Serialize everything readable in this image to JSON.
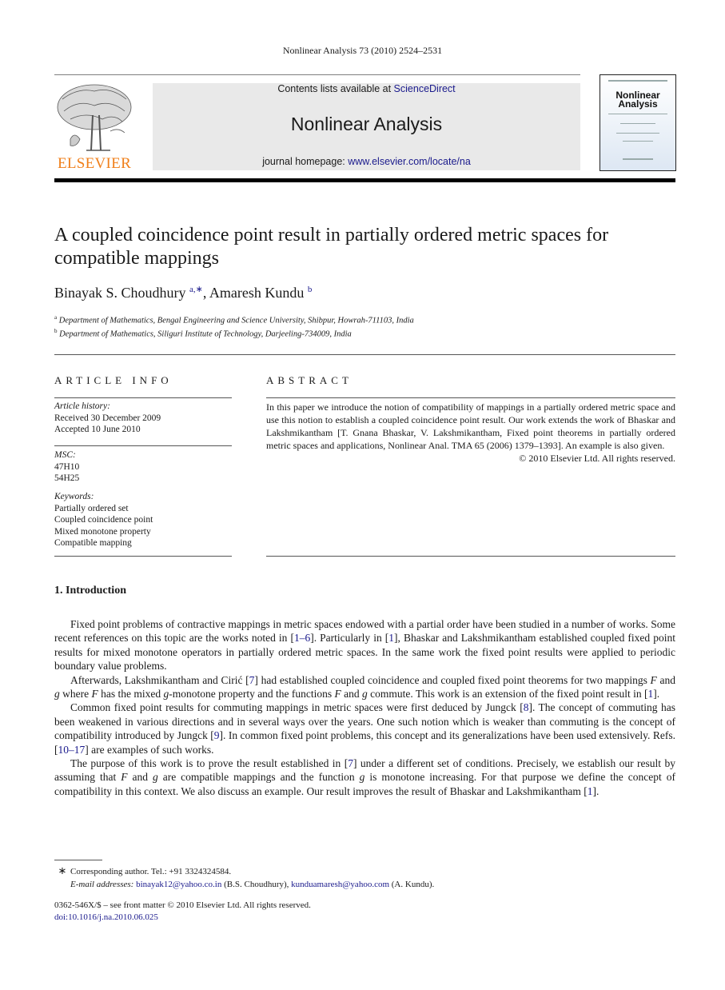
{
  "header": {
    "running_head": "Nonlinear Analysis 73 (2010) 2524–2531",
    "publisher_logo_text": "ELSEVIER",
    "contents_prefix": "Contents lists available at ",
    "contents_link": "ScienceDirect",
    "journal_title": "Nonlinear Analysis",
    "homepage_prefix": "journal homepage: ",
    "homepage_link": "www.elsevier.com/locate/na",
    "cover_title_line1": "Nonlinear",
    "cover_title_line2": "Analysis"
  },
  "article": {
    "title": "A coupled coincidence point result in partially ordered metric spaces for compatible mappings",
    "authors": [
      {
        "name": "Binayak S. Choudhury",
        "marks": "a,∗"
      },
      {
        "name": "Amaresh Kundu",
        "marks": "b"
      }
    ],
    "author_separator": ", ",
    "affiliations": [
      {
        "mark": "a",
        "text": "Department of Mathematics, Bengal Engineering and Science University, Shibpur, Howrah-711103, India"
      },
      {
        "mark": "b",
        "text": "Department of Mathematics, Siliguri Institute of Technology, Darjeeling-734009, India"
      }
    ]
  },
  "article_info": {
    "heading": "ARTICLE INFO",
    "history_label": "Article history:",
    "received": "Received 30 December 2009",
    "accepted": "Accepted 10 June 2010",
    "msc_label": "MSC:",
    "msc": [
      "47H10",
      "54H25"
    ],
    "keywords_label": "Keywords:",
    "keywords": [
      "Partially ordered set",
      "Coupled coincidence point",
      "Mixed monotone property",
      "Compatible mapping"
    ]
  },
  "abstract": {
    "heading": "ABSTRACT",
    "text": "In this paper we introduce the notion of compatibility of mappings in a partially ordered metric space and use this notion to establish a coupled coincidence point result. Our work extends the work of Bhaskar and Lakshmikantham [T. Gnana Bhaskar, V. Lakshmikantham, Fixed point theorems in partially ordered metric spaces and applications, Nonlinear Anal. TMA 65 (2006) 1379–1393]. An example is also given.",
    "copyright": "© 2010 Elsevier Ltd. All rights reserved."
  },
  "section1": {
    "heading": "1.  Introduction",
    "p1": {
      "a": "Fixed point problems of contractive mappings in metric spaces endowed with a partial order have been studied in a number of works. Some recent references on this topic are the works noted in [",
      "ref1": "1–6",
      "b": "]. Particularly in [",
      "ref2": "1",
      "c": "], Bhaskar and Lakshmikantham established coupled fixed point results for mixed monotone operators in partially ordered metric spaces. In the same work the fixed point results were applied to periodic boundary value problems."
    },
    "p2": {
      "a": "Afterwards, Lakshmikantham and Cirić [",
      "ref1": "7",
      "b": "] had established coupled coincidence and coupled fixed point theorems for two mappings ",
      "F": "F",
      "and": " and ",
      "g": "g",
      "c": " where ",
      "d": " has the mixed ",
      "e": "-monotone property and the functions ",
      "f": " commute. This work is an extension of the fixed point result in [",
      "ref2": "1",
      "end": "]."
    },
    "p3": {
      "a": "Common fixed point results for commuting mappings in metric spaces were first deduced by Jungck [",
      "ref1": "8",
      "b": "]. The concept of commuting has been weakened in various directions and in several ways over the years. One such notion which is weaker than commuting is the concept of compatibility introduced by Jungck [",
      "ref2": "9",
      "c": "]. In common fixed point problems, this concept and its generalizations have been used extensively. Refs. [",
      "ref3": "10–17",
      "d": "] are examples of such works."
    },
    "p4": {
      "a": "The purpose of this work is to prove the result established in [",
      "ref1": "7",
      "b": "] under a different set of conditions. Precisely, we establish our result by assuming that ",
      "c": " are compatible mappings and the function ",
      "d": " is monotone increasing. For that purpose we define the concept of compatibility in this context. We also discuss an example. Our result improves the result of Bhaskar and Lakshmikantham [",
      "ref2": "1",
      "end": "]."
    }
  },
  "footnotes": {
    "star": "∗",
    "corresponding": "Corresponding author. Tel.: +91 3324324584.",
    "email_label": "E-mail addresses: ",
    "email1": "binayak12@yahoo.co.in",
    "email1_owner": " (B.S. Choudhury), ",
    "email2": "kunduamaresh@yahoo.com",
    "email2_owner": " (A. Kundu).",
    "front_matter": "0362-546X/$ – see front matter © 2010 Elsevier Ltd. All rights reserved.",
    "doi": "doi:10.1016/j.na.2010.06.025"
  }
}
